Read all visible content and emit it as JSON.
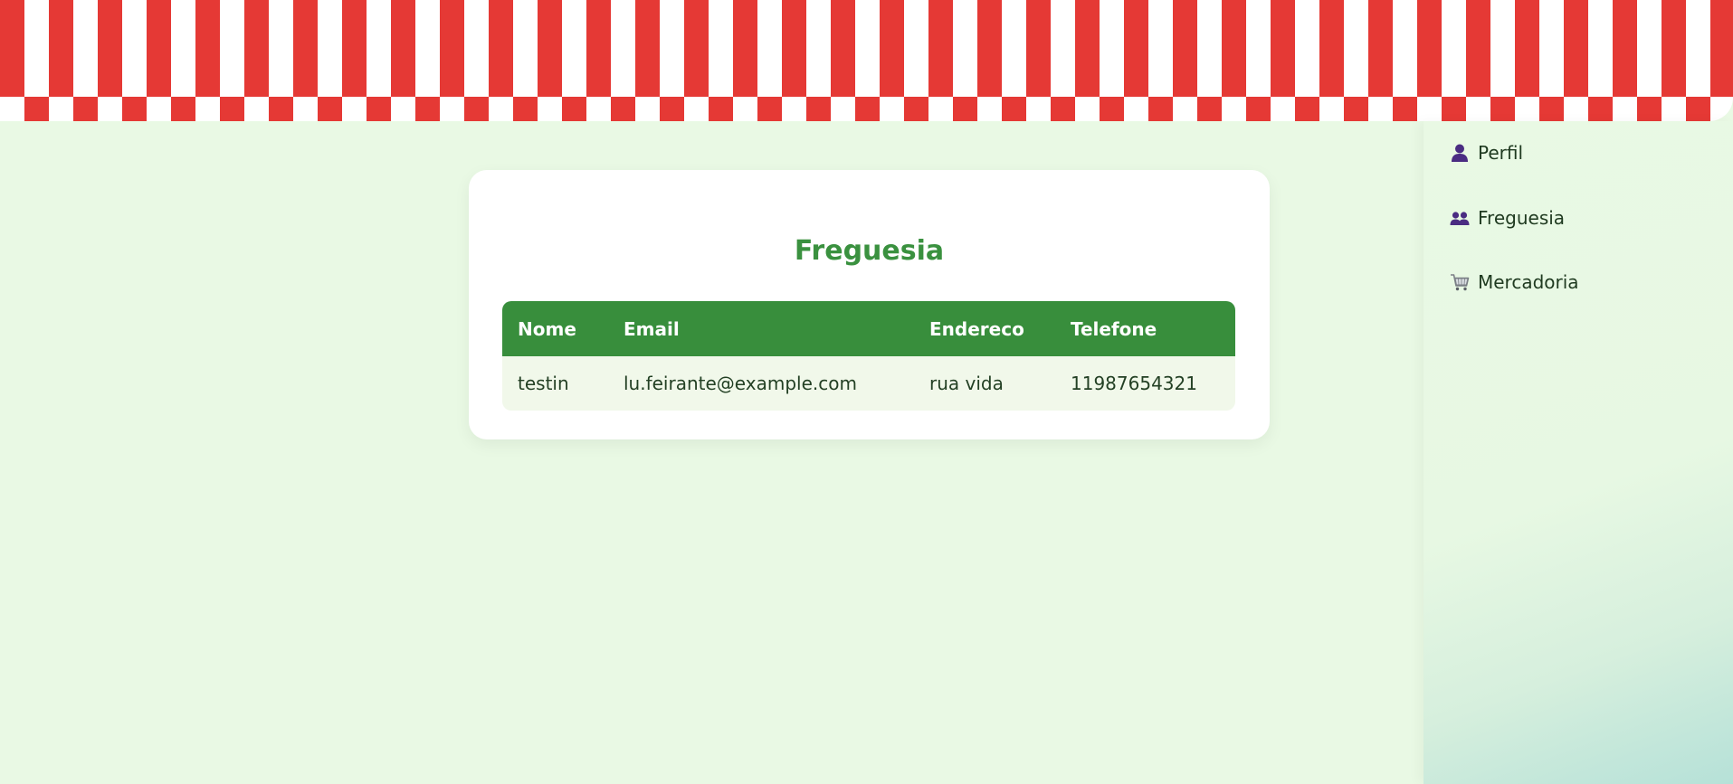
{
  "colors": {
    "banner_red": "#e53935",
    "banner_white": "#ffffff",
    "page_bg": "#e9f9e4",
    "title_green": "#3a913f",
    "header_green": "#388e3c",
    "row_bg": "#f1f8ea",
    "icon_purple": "#4a2c82"
  },
  "sidebar": {
    "items": [
      {
        "label": "Perfil",
        "icon": "user-icon"
      },
      {
        "label": "Freguesia",
        "icon": "users-icon"
      },
      {
        "label": "Mercadoria",
        "icon": "cart-icon"
      }
    ]
  },
  "main": {
    "title": "Freguesia",
    "table": {
      "headers": [
        "Nome",
        "Email",
        "Endereco",
        "Telefone"
      ],
      "rows": [
        [
          "testin",
          "lu.feirante@example.com",
          "rua vida",
          "11987654321"
        ]
      ]
    }
  }
}
